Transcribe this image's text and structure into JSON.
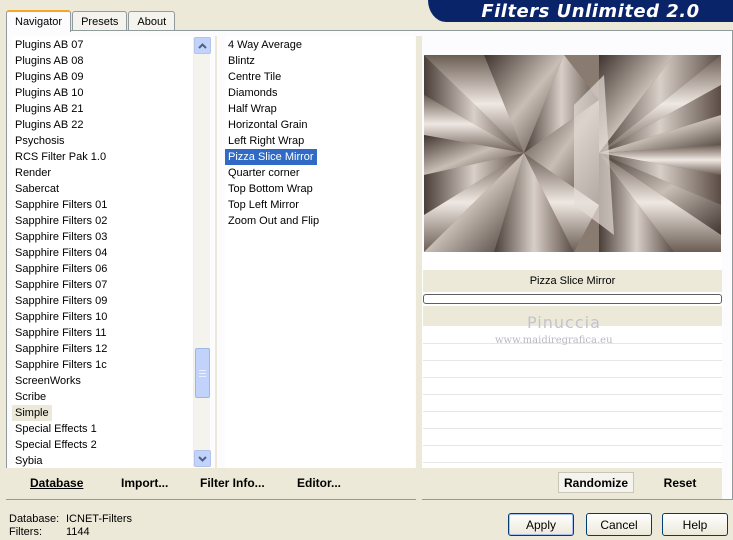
{
  "tabs": [
    "Navigator",
    "Presets",
    "About"
  ],
  "banner_title": "Filters Unlimited 2.0",
  "categories": [
    "Plugins AB 07",
    "Plugins AB 08",
    "Plugins AB 09",
    "Plugins AB 10",
    "Plugins AB 21",
    "Plugins AB 22",
    "Psychosis",
    "RCS Filter Pak 1.0",
    "Render",
    "Sabercat",
    "Sapphire Filters 01",
    "Sapphire Filters 02",
    "Sapphire Filters 03",
    "Sapphire Filters 04",
    "Sapphire Filters 06",
    "Sapphire Filters 07",
    "Sapphire Filters 09",
    "Sapphire Filters 10",
    "Sapphire Filters 11",
    "Sapphire Filters 12",
    "Sapphire Filters 1c",
    "ScreenWorks",
    "Scribe",
    "Simple",
    "Special Effects 1",
    "Special Effects 2",
    "Sybia"
  ],
  "selected_category": "Simple",
  "filters": [
    "4 Way Average",
    "Blintz",
    "Centre Tile",
    "Diamonds",
    "Half Wrap",
    "Horizontal Grain",
    "Left Right Wrap",
    "Pizza Slice Mirror",
    "Quarter corner",
    "Top Bottom Wrap",
    "Top Left Mirror",
    "Zoom Out and Flip"
  ],
  "selected_filter": "Pizza Slice Mirror",
  "current_filter_name": "Pizza Slice Mirror",
  "watermark": {
    "name": "Pinuccia",
    "url": "www.maidiregrafica.eu"
  },
  "toolbar": {
    "database": "Database",
    "import": "Import...",
    "filter_info": "Filter Info...",
    "editor": "Editor...",
    "randomize": "Randomize",
    "reset": "Reset"
  },
  "status": {
    "database_label": "Database:",
    "database_value": "ICNET-Filters",
    "filters_label": "Filters:",
    "filters_value": "1144"
  },
  "buttons": {
    "apply": "Apply",
    "cancel": "Cancel",
    "help": "Help"
  },
  "colors": {
    "selection": "#316ac5",
    "banner": "#0a246a",
    "face": "#ece9d8"
  }
}
